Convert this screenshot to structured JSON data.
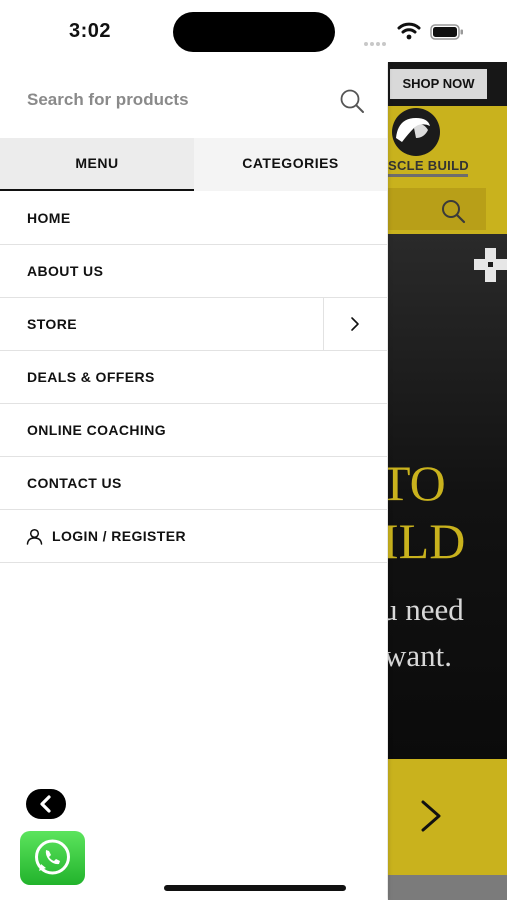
{
  "status_bar": {
    "time": "3:02",
    "icons": [
      "signal-icon",
      "wifi-icon",
      "battery-icon"
    ]
  },
  "drawer": {
    "search": {
      "placeholder": "Search for products",
      "value": ""
    },
    "tabs": [
      {
        "label": "MENU",
        "active": true
      },
      {
        "label": "CATEGORIES",
        "active": false
      }
    ],
    "menu_items": [
      {
        "label": "HOME"
      },
      {
        "label": "ABOUT US"
      },
      {
        "label": "STORE",
        "has_submenu": true
      },
      {
        "label": "DEALS & OFFERS"
      },
      {
        "label": "ONLINE COACHING"
      },
      {
        "label": "CONTACT US"
      },
      {
        "label": "LOGIN / REGISTER",
        "icon": "user-icon"
      }
    ]
  },
  "background_site": {
    "shop_now_label": "SHOP NOW",
    "logo_text": "SCLE BUILD",
    "hero_word_1": "TO",
    "hero_word_2": "ILD",
    "hero_line_1": "u need",
    "hero_line_2": "want."
  },
  "colors": {
    "brand_yellow": "#c9b21d",
    "whatsapp_green": "#25c03a",
    "text_dark": "#111111"
  }
}
